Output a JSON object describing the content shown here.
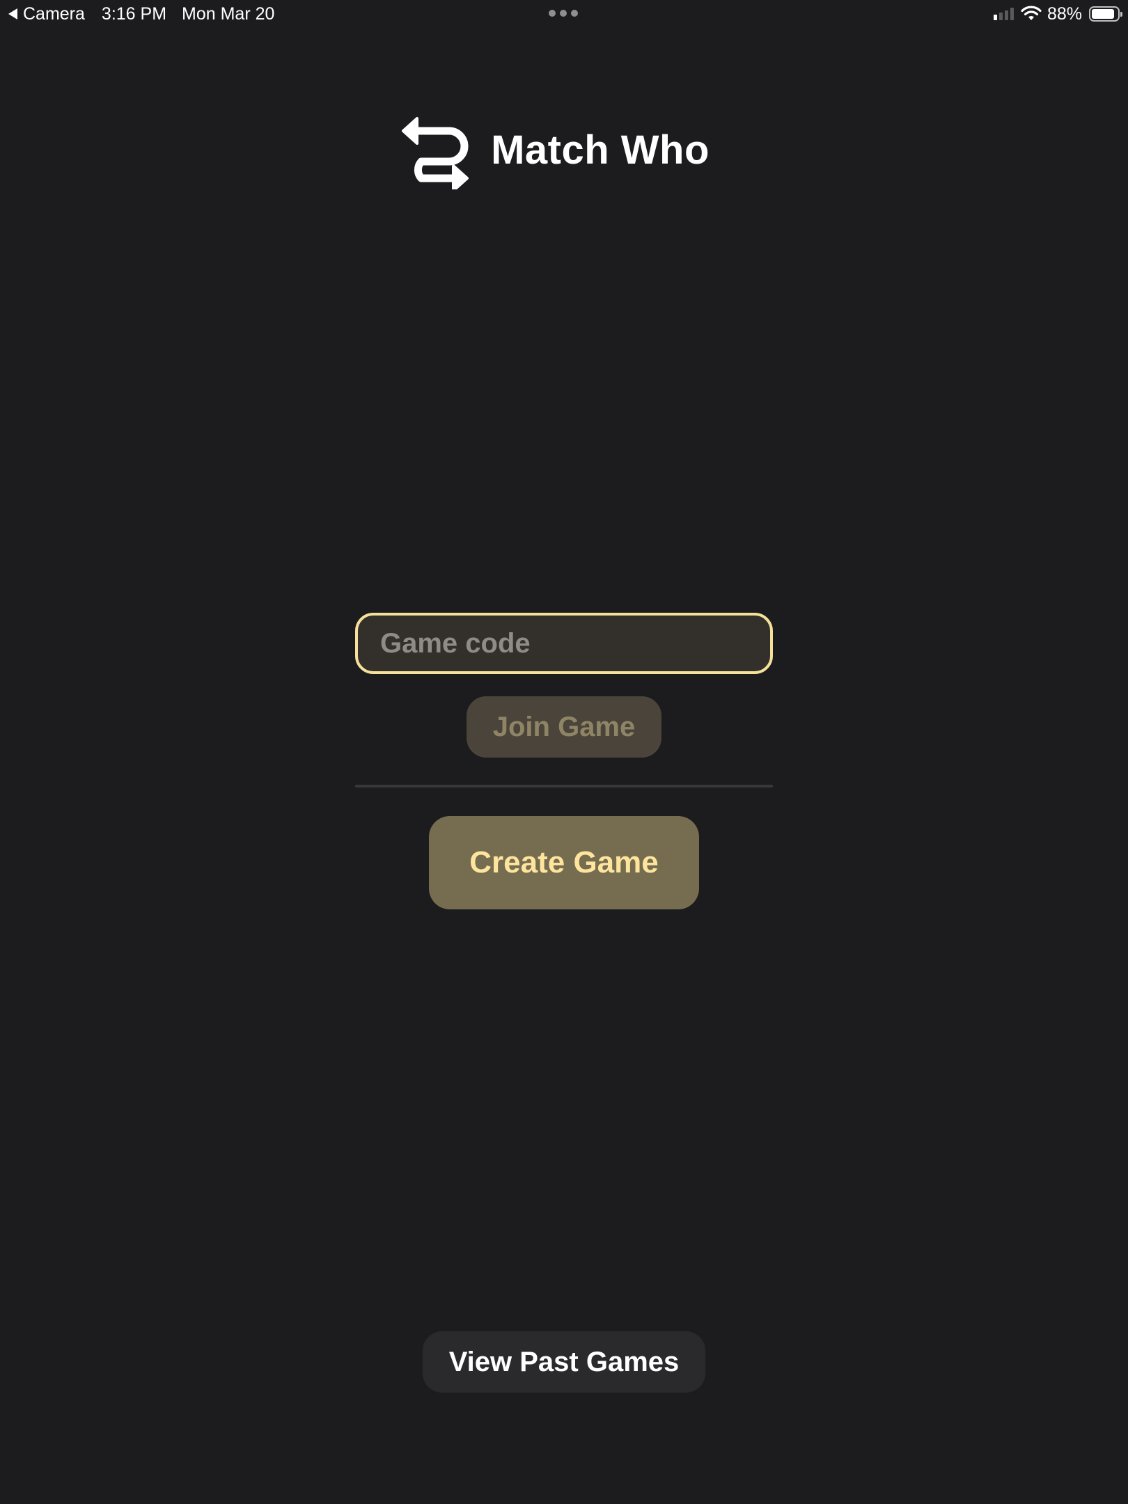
{
  "status_bar": {
    "back_app": "Camera",
    "time": "3:16 PM",
    "date": "Mon Mar 20",
    "battery_percent": "88%",
    "battery_level": 0.88,
    "signal_bars_active": 1,
    "signal_bars_total": 4,
    "back_icon": "back-triangle-icon",
    "wifi_icon": "wifi-icon",
    "battery_icon": "battery-icon",
    "multitask_icon": "ellipsis-icon"
  },
  "header": {
    "title": "Match Who",
    "logo_icon": "swap-arrows-icon"
  },
  "join": {
    "code_placeholder": "Game code",
    "code_value": "",
    "join_label": "Join Game"
  },
  "create": {
    "create_label": "Create Game"
  },
  "footer": {
    "past_games_label": "View Past Games"
  },
  "colors": {
    "background": "#1c1c1e",
    "accent": "#f5e19a",
    "create_button_bg": "#766c50",
    "create_button_text": "#fde59e",
    "join_button_bg": "#4b443a",
    "join_button_text": "#8f8566",
    "input_bg": "#332f2b",
    "secondary_button_bg": "#2a2a2d"
  }
}
